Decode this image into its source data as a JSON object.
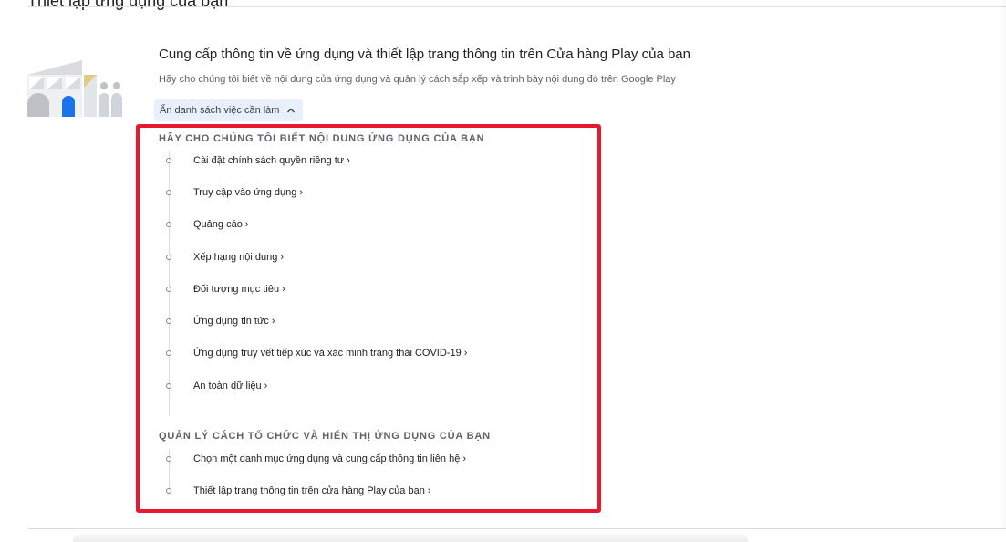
{
  "page": {
    "heading": "Thiết lập ứng dụng của bạn"
  },
  "section": {
    "title": "Cung cấp thông tin về ứng dụng và thiết lập trang thông tin trên Cửa hàng Play của bạn",
    "subtitle": "Hãy cho chúng tôi biết về nội dung của ứng dụng và quản lý cách sắp xếp và trình bày nội dung đó trên Google Play",
    "toggle_label": "Ẩn danh sách việc cần làm",
    "toggle_icon": "chevron-up-icon"
  },
  "groups": [
    {
      "heading": "HÃY CHO CHÚNG TÔI BIẾT NỘI DUNG ỨNG DỤNG CỦA BẠN",
      "tasks": [
        {
          "label": "Cài đặt chính sách quyền riêng tư"
        },
        {
          "label": "Truy cập vào ứng dụng"
        },
        {
          "label": "Quảng cáo"
        },
        {
          "label": "Xếp hạng nội dung"
        },
        {
          "label": "Đối tượng mục tiêu"
        },
        {
          "label": "Ứng dụng tin tức"
        },
        {
          "label": "Ứng dụng truy vết tiếp xúc và xác minh trạng thái COVID-19"
        },
        {
          "label": "An toàn dữ liệu"
        }
      ]
    },
    {
      "heading": "QUẢN LÝ CÁCH TỔ CHỨC VÀ HIỂN THỊ ỨNG DỤNG CỦA BẠN",
      "tasks": [
        {
          "label": "Chọn một danh mục ứng dụng và cung cấp thông tin liên hệ"
        },
        {
          "label": "Thiết lập trang thông tin trên cửa hàng Play của bạn"
        }
      ]
    }
  ],
  "task_arrow": "›",
  "colors": {
    "highlight_border": "#e8192c",
    "toggle_bg": "#e8f0fe",
    "illustration_blue": "#1a73e8",
    "illustration_yellow": "#fbbc04"
  }
}
